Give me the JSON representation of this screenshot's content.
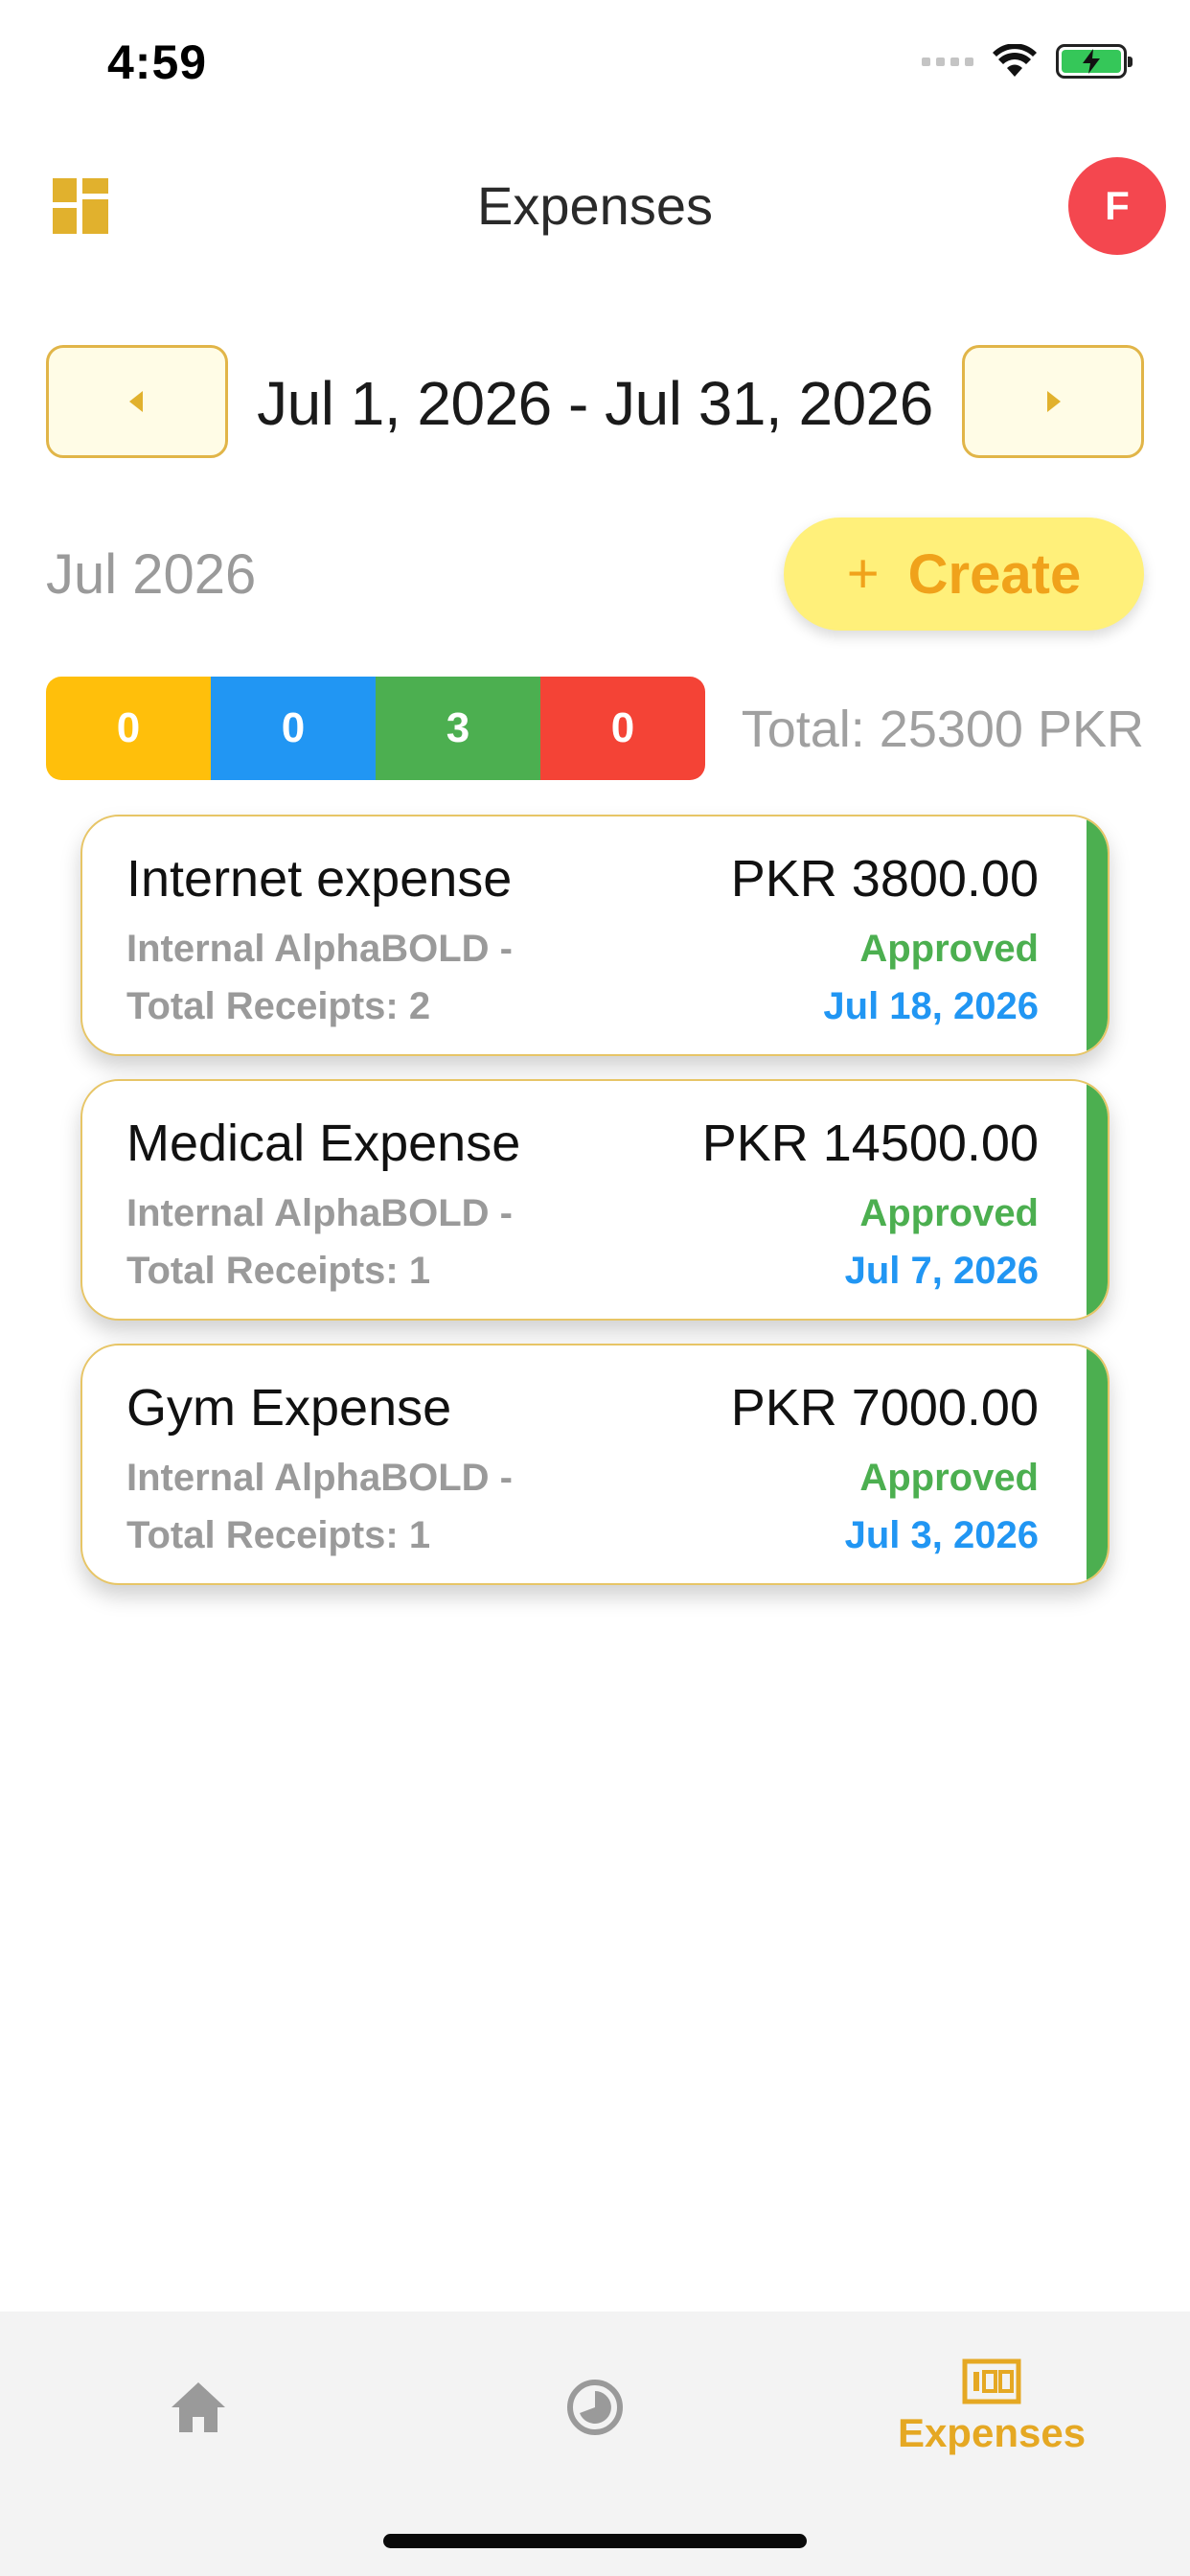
{
  "status_bar": {
    "time": "4:59"
  },
  "header": {
    "title": "Expenses",
    "avatar_initial": "F"
  },
  "date_nav": {
    "range": "Jul 1, 2026 - Jul 31, 2026"
  },
  "summary": {
    "month": "Jul 2026",
    "create_label": "Create",
    "create_plus": "+",
    "counts": [
      {
        "value": "0",
        "color": "#ffbf0b"
      },
      {
        "value": "0",
        "color": "#2196f3"
      },
      {
        "value": "3",
        "color": "#4caf50"
      },
      {
        "value": "0",
        "color": "#f44336"
      }
    ],
    "total": "Total: 25300 PKR"
  },
  "expenses": [
    {
      "title": "Internet expense",
      "amount": "PKR 3800.00",
      "project": "Internal AlphaBOLD -",
      "receipts": "Total Receipts: 2",
      "status": "Approved",
      "date": "Jul 18, 2026"
    },
    {
      "title": "Medical Expense",
      "amount": "PKR 14500.00",
      "project": "Internal AlphaBOLD -",
      "receipts": "Total Receipts: 1",
      "status": "Approved",
      "date": "Jul 7, 2026"
    },
    {
      "title": "Gym Expense",
      "amount": "PKR 7000.00",
      "project": "Internal AlphaBOLD -",
      "receipts": "Total Receipts: 1",
      "status": "Approved",
      "date": "Jul 3, 2026"
    }
  ],
  "tabs": {
    "home_icon": "home-icon",
    "history_icon": "pie-chart-icon",
    "expenses_icon": "receipt-icon",
    "expenses_label": "Expenses"
  },
  "colors": {
    "accent": "#e5a823",
    "approved": "#4caf50",
    "date": "#2196f3",
    "avatar": "#f4474f"
  }
}
